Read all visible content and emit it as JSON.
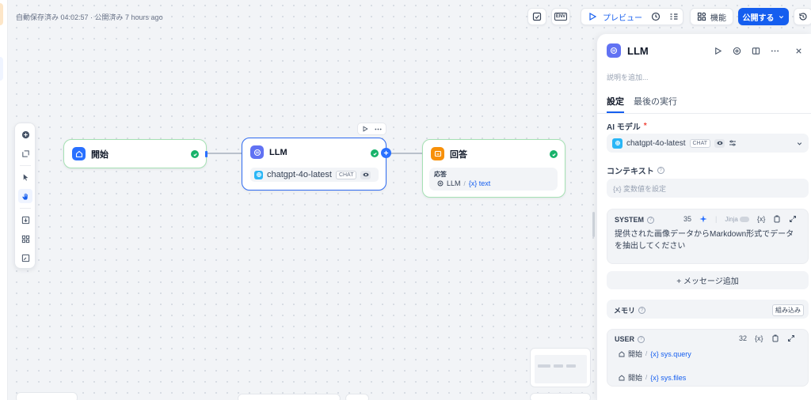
{
  "topbar": {
    "autosave_text": "自動保存済み 04:02:57 · 公開済み 7 hours ago",
    "env_label": "ENV",
    "preview_label": "プレビュー",
    "features_label": "機能",
    "publish_label": "公開する"
  },
  "canvas": {
    "start_node": {
      "title": "開始"
    },
    "llm_node": {
      "title": "LLM",
      "model": "chatgpt-4o-latest",
      "mode_chip": "CHAT"
    },
    "answer_node": {
      "title": "回答",
      "field_label": "応答",
      "ref_node": "LLM",
      "ref_var": "{x} text"
    }
  },
  "panel": {
    "title": "LLM",
    "description_placeholder": "説明を追加...",
    "tabs": [
      "設定",
      "最後の実行"
    ],
    "ai_model_label": "AI モデル",
    "required_mark": "*",
    "model_name": "chatgpt-4o-latest",
    "model_chip": "CHAT",
    "context_label": "コンテキスト",
    "context_placeholder": "{x}  変数値を設定",
    "system": {
      "label": "SYSTEM",
      "count": "35",
      "jinja_label": "Jinja",
      "var_icon_label": "{x}",
      "text": "提供された画像データからMarkdown形式でデータを抽出してください"
    },
    "add_message_label": "+ メッセージ追加",
    "memory_label": "メモリ",
    "memory_badge": "組み込み",
    "user": {
      "label": "USER",
      "count": "32",
      "var_icon_label": "{x}",
      "refs": [
        {
          "node": "開始",
          "var": "{x} sys.query"
        },
        {
          "node": "開始",
          "var": "{x} sys.files"
        }
      ]
    }
  },
  "colors": {
    "accent": "#155eef",
    "success": "#17b26a",
    "start_node_icon": "#2970ff",
    "llm_node_icon": "#6172f3",
    "answer_node_icon": "#f79009"
  }
}
